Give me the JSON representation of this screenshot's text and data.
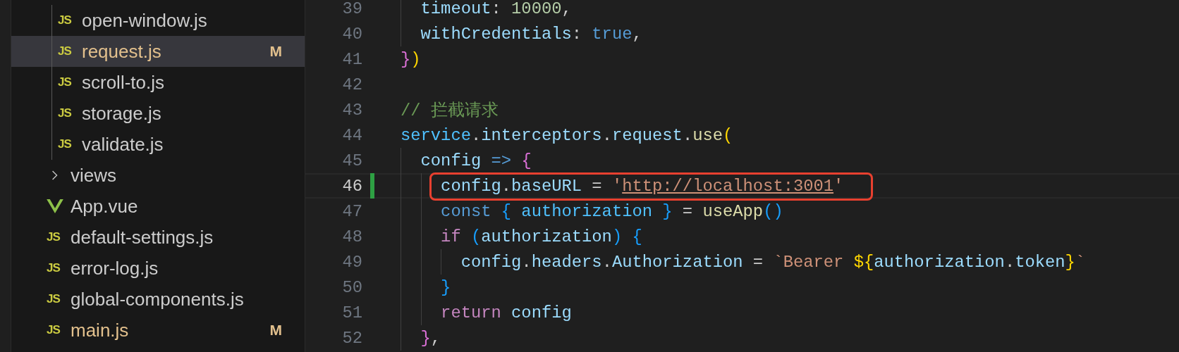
{
  "sidebar": {
    "items": [
      {
        "expanded": true,
        "children": [
          {
            "name": "open-window.js",
            "kind": "js",
            "icon": "JS",
            "selected": false
          },
          {
            "name": "request.js",
            "kind": "js",
            "icon": "JS",
            "badge": "M",
            "selected": true
          },
          {
            "name": "scroll-to.js",
            "kind": "js",
            "icon": "JS",
            "selected": false
          },
          {
            "name": "storage.js",
            "kind": "js",
            "icon": "JS",
            "selected": false
          },
          {
            "name": "validate.js",
            "kind": "js",
            "icon": "JS",
            "selected": false
          }
        ]
      },
      {
        "name": "views",
        "kind": "folder",
        "expanded": false,
        "selected": false
      },
      {
        "name": "App.vue",
        "kind": "vue",
        "selected": false
      },
      {
        "name": "default-settings.js",
        "kind": "js",
        "icon": "JS",
        "selected": false
      },
      {
        "name": "error-log.js",
        "kind": "js",
        "icon": "JS",
        "selected": false
      },
      {
        "name": "global-components.js",
        "kind": "js",
        "icon": "JS",
        "selected": false
      },
      {
        "name": "main.js",
        "kind": "js",
        "icon": "JS",
        "badge": "M",
        "selected": false
      }
    ]
  },
  "editor": {
    "lines": [
      {
        "number": "39",
        "current": false,
        "modified": false,
        "annotated": false,
        "tokens": [
          {
            "t": "  timeout",
            "kind": "prop"
          },
          {
            "t": ": ",
            "kind": "punc"
          },
          {
            "t": "10000",
            "kind": "num"
          },
          {
            "t": ",",
            "kind": "punc"
          }
        ]
      },
      {
        "number": "40",
        "current": false,
        "modified": false,
        "annotated": false,
        "tokens": [
          {
            "t": "  withCredentials",
            "kind": "prop"
          },
          {
            "t": ": ",
            "kind": "punc"
          },
          {
            "t": "true",
            "kind": "kw"
          },
          {
            "t": ",",
            "kind": "punc"
          }
        ]
      },
      {
        "number": "41",
        "current": false,
        "modified": false,
        "annotated": false,
        "tokens": [
          {
            "t": "}",
            "kind": "b2"
          },
          {
            "t": ")",
            "kind": "b1"
          }
        ]
      },
      {
        "number": "42",
        "current": false,
        "modified": false,
        "annotated": false
      },
      {
        "number": "43",
        "current": false,
        "modified": false,
        "annotated": false,
        "tokens": [
          {
            "t": "// 拦截请求",
            "kind": "comment"
          }
        ]
      },
      {
        "number": "44",
        "current": false,
        "modified": false,
        "annotated": false,
        "tokens": [
          {
            "t": "service",
            "kind": "const"
          },
          {
            "t": ".",
            "kind": "punc"
          },
          {
            "t": "interceptors",
            "kind": "prop"
          },
          {
            "t": ".",
            "kind": "punc"
          },
          {
            "t": "request",
            "kind": "prop"
          },
          {
            "t": ".",
            "kind": "punc"
          },
          {
            "t": "use",
            "kind": "fn"
          },
          {
            "t": "(",
            "kind": "b1"
          }
        ]
      },
      {
        "number": "45",
        "current": false,
        "modified": false,
        "annotated": false,
        "tokens": [
          {
            "t": "  config ",
            "kind": "var"
          },
          {
            "t": "=> ",
            "kind": "kw"
          },
          {
            "t": "{",
            "kind": "b2"
          }
        ]
      },
      {
        "number": "46",
        "current": true,
        "modified": true,
        "annotated": true,
        "tokens": [
          {
            "t": "    config",
            "kind": "var"
          },
          {
            "t": ".",
            "kind": "punc"
          },
          {
            "t": "baseURL",
            "kind": "prop"
          },
          {
            "t": " = ",
            "kind": "punc"
          },
          {
            "t": "'",
            "kind": "str"
          },
          {
            "t": "http://localhost:3001",
            "kind": "url"
          },
          {
            "t": "'",
            "kind": "str"
          }
        ]
      },
      {
        "number": "47",
        "current": false,
        "modified": false,
        "annotated": false,
        "tokens": [
          {
            "t": "    const ",
            "kind": "kw"
          },
          {
            "t": "{",
            "kind": "b3"
          },
          {
            "t": " authorization ",
            "kind": "const"
          },
          {
            "t": "}",
            "kind": "b3"
          },
          {
            "t": " = ",
            "kind": "punc"
          },
          {
            "t": "useApp",
            "kind": "fn"
          },
          {
            "t": "()",
            "kind": "b3"
          }
        ]
      },
      {
        "number": "48",
        "current": false,
        "modified": false,
        "annotated": false,
        "tokens": [
          {
            "t": "    if ",
            "kind": "ctrl"
          },
          {
            "t": "(",
            "kind": "b3"
          },
          {
            "t": "authorization",
            "kind": "var"
          },
          {
            "t": ") {",
            "kind": "b3"
          }
        ]
      },
      {
        "number": "49",
        "current": false,
        "modified": false,
        "annotated": false,
        "tokens": [
          {
            "t": "      config",
            "kind": "var"
          },
          {
            "t": ".",
            "kind": "punc"
          },
          {
            "t": "headers",
            "kind": "prop"
          },
          {
            "t": ".",
            "kind": "punc"
          },
          {
            "t": "Authorization",
            "kind": "prop"
          },
          {
            "t": " = ",
            "kind": "punc"
          },
          {
            "t": "`Bearer ",
            "kind": "str"
          },
          {
            "t": "${",
            "kind": "b1"
          },
          {
            "t": "authorization",
            "kind": "var"
          },
          {
            "t": ".",
            "kind": "punc"
          },
          {
            "t": "token",
            "kind": "prop"
          },
          {
            "t": "}",
            "kind": "b1"
          },
          {
            "t": "`",
            "kind": "str"
          }
        ]
      },
      {
        "number": "50",
        "current": false,
        "modified": false,
        "annotated": false,
        "tokens": [
          {
            "t": "    }",
            "kind": "b3"
          }
        ]
      },
      {
        "number": "51",
        "current": false,
        "modified": false,
        "annotated": false,
        "tokens": [
          {
            "t": "    return ",
            "kind": "ctrl"
          },
          {
            "t": "config",
            "kind": "var"
          }
        ]
      },
      {
        "number": "52",
        "current": false,
        "modified": false,
        "annotated": false,
        "tokens": [
          {
            "t": "  }",
            "kind": "b2"
          },
          {
            "t": ",",
            "kind": "punc"
          }
        ]
      }
    ]
  }
}
